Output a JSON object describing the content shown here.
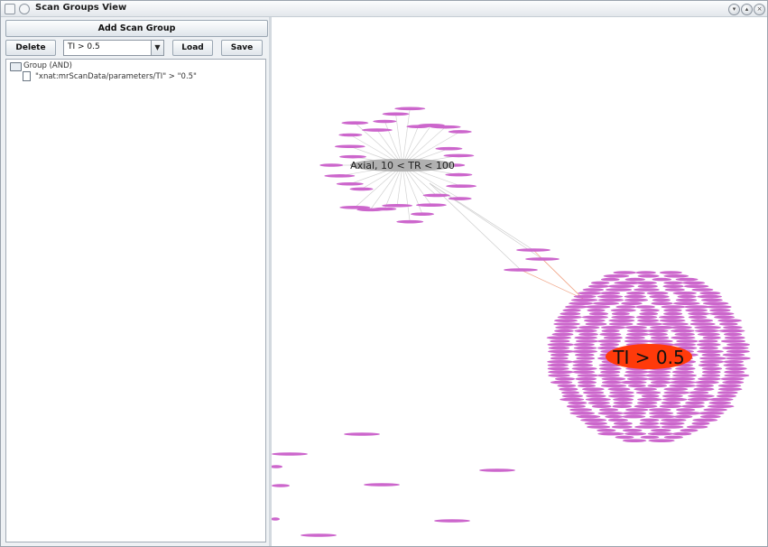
{
  "window": {
    "title": "Scan Groups View"
  },
  "toolbar": {
    "add_label": "Add Scan Group",
    "delete_label": "Delete",
    "load_label": "Load",
    "save_label": "Save",
    "combo_value": "TI > 0.5",
    "combo_arrow": "▼"
  },
  "tree": {
    "root_label": "Group (AND)",
    "child_label": "\"xnat:mrScanData/parameters/TI\" > \"0.5\""
  },
  "graph": {
    "secondary_node_label": "Axial, 10 < TR < 100",
    "primary_node_label": "TI > 0.5",
    "colors": {
      "primary_node": "#ff3a0a",
      "secondary_node": "#b0b0b0",
      "leaf_node": "#cc66cc",
      "edge_primary": "#f0a080",
      "edge_secondary": "#c8c8c8"
    }
  }
}
